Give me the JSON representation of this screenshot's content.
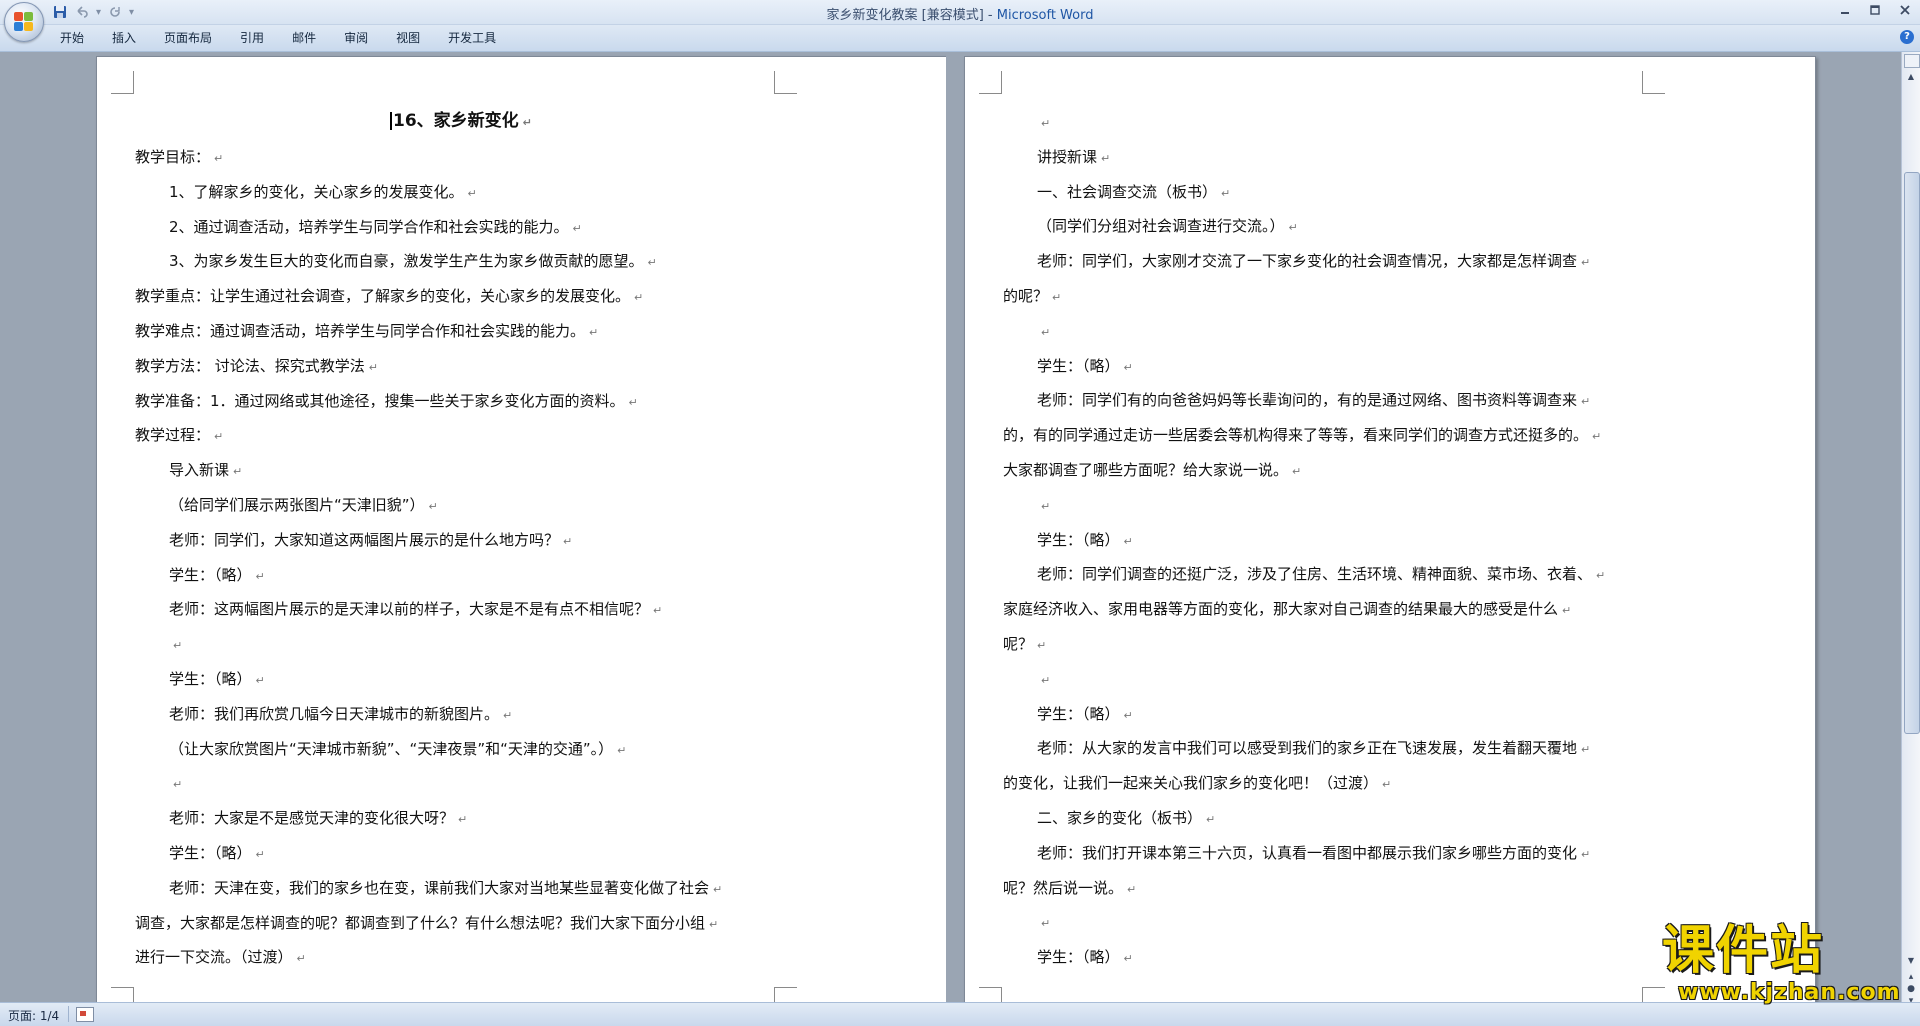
{
  "window": {
    "title": "家乡新变化教案 [兼容模式]",
    "title_sep": " - ",
    "app": "Microsoft Word",
    "min_icon": "minimize-icon",
    "max_icon": "maximize-icon",
    "close_icon": "close-icon"
  },
  "qat": {
    "save_icon": "save-icon",
    "undo_icon": "undo-icon",
    "redo_icon": "redo-icon",
    "customize_icon": "chevron-down-icon"
  },
  "ribbon": {
    "tabs": [
      "开始",
      "插入",
      "页面布局",
      "引用",
      "邮件",
      "审阅",
      "视图",
      "开发工具"
    ],
    "help": "?"
  },
  "left_page": {
    "title": "16、家乡新变化",
    "lines": [
      "教学目标：",
      "1、了解家乡的变化，关心家乡的发展变化。",
      "2、通过调查活动，培养学生与同学合作和社会实践的能力。",
      "3、为家乡发生巨大的变化而自豪，激发学生产生为家乡做贡献的愿望。",
      "教学重点：让学生通过社会调查，了解家乡的变化，关心家乡的发展变化。",
      "教学难点：通过调查活动，培养学生与同学合作和社会实践的能力。",
      "教学方法： 讨论法、探究式教学法",
      "教学准备：1．通过网络或其他途径，搜集一些关于家乡变化方面的资料。",
      "教学过程：",
      "导入新课",
      "（给同学们展示两张图片“天津旧貌”）",
      "老师：同学们，大家知道这两幅图片展示的是什么地方吗？",
      "学生：（略）",
      "老师：这两幅图片展示的是天津以前的样子，大家是不是有点不相信呢？",
      "",
      "学生：（略）",
      "老师：我们再欣赏几幅今日天津城市的新貌图片。",
      "（让大家欣赏图片“天津城市新貌”、“天津夜景”和“天津的交通”。）",
      "",
      "老师：大家是不是感觉天津的变化很大呀？",
      "学生：（略）",
      "老师：天津在变，我们的家乡也在变，课前我们大家对当地某些显著变化做了社会",
      "调查，大家都是怎样调查的呢？都调查到了什么？有什么想法呢？我们大家下面分小组",
      "进行一下交流。（过渡）"
    ]
  },
  "right_page": {
    "lines": [
      "",
      "讲授新课",
      "一、社会调查交流（板书）",
      "（同学们分组对社会调查进行交流。）",
      "老师：同学们，大家刚才交流了一下家乡变化的社会调查情况，大家都是怎样调查",
      "的呢？",
      "",
      "学生：（略）",
      "老师：同学们有的向爸爸妈妈等长辈询问的，有的是通过网络、图书资料等调查来",
      "的，有的同学通过走访一些居委会等机构得来了等等，看来同学们的调查方式还挺多的。",
      "大家都调查了哪些方面呢？给大家说一说。",
      "",
      "学生：（略）",
      "老师：同学们调查的还挺广泛，涉及了住房、生活环境、精神面貌、菜市场、衣着、",
      "家庭经济收入、家用电器等方面的变化，那大家对自己调查的结果最大的感受是什么",
      "呢？",
      "",
      "学生：（略）",
      "老师：从大家的发言中我们可以感受到我们的家乡正在飞速发展，发生着翻天覆地",
      "的变化，让我们一起来关心我们家乡的变化吧！（过渡）",
      "二、家乡的变化（板书）",
      "老师：我们打开课本第三十六页，认真看一看图中都展示我们家乡哪些方面的变化",
      "呢？然后说一说。",
      "",
      "学生：（略）"
    ]
  },
  "paragraph_mark": "↵",
  "status": {
    "page": "页面: 1/4"
  },
  "watermark": {
    "text": "课件站",
    "url": "www.kjzhan.com"
  }
}
